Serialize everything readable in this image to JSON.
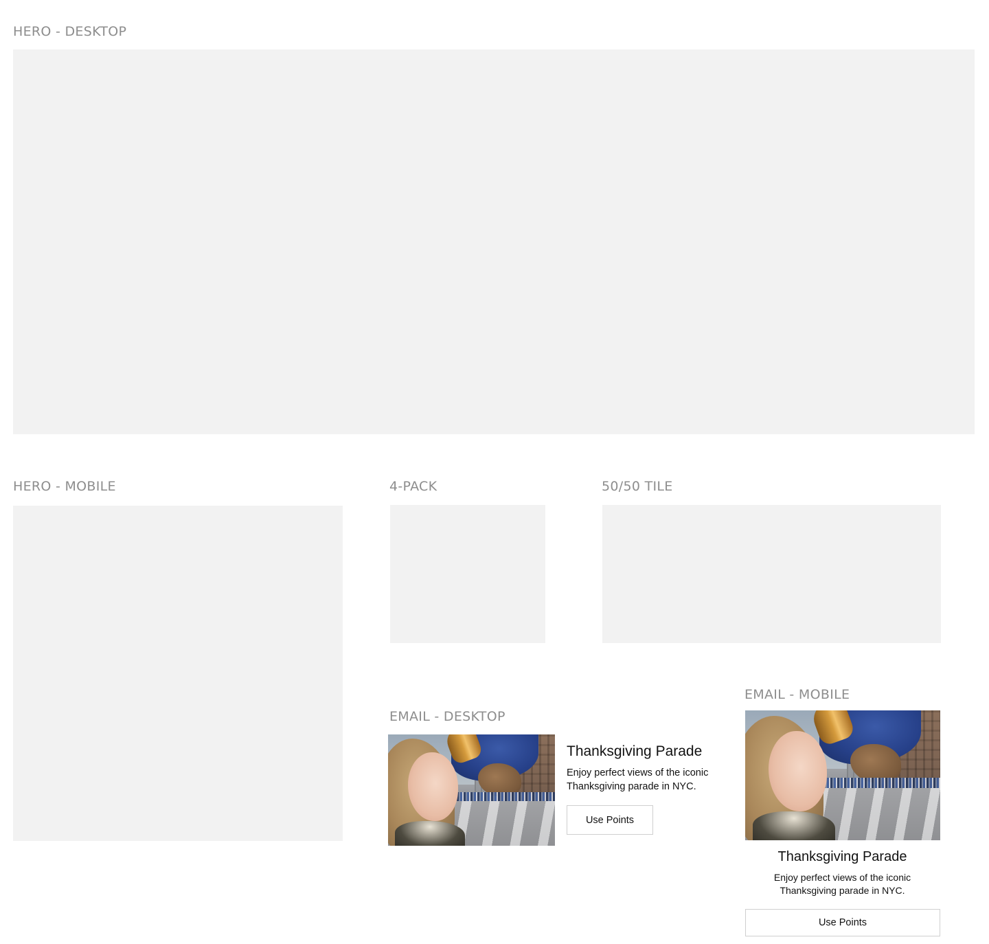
{
  "sections": {
    "hero_desktop": {
      "label": "HERO - DESKTOP"
    },
    "hero_mobile": {
      "label": "HERO - MOBILE"
    },
    "four_pack": {
      "label": "4-PACK"
    },
    "fifty_fifty": {
      "label": "50/50 TILE"
    },
    "email_desktop": {
      "label": "EMAIL - DESKTOP",
      "title": "Thanksgiving Parade",
      "description": "Enjoy perfect views of the iconic Thanksgiving parade in NYC.",
      "button_label": "Use Points"
    },
    "email_mobile": {
      "label": "EMAIL - MOBILE",
      "title": "Thanksgiving Parade",
      "description": "Enjoy perfect views of the iconic Thanksgiving parade in NYC.",
      "button_label": "Use Points"
    }
  },
  "colors": {
    "placeholder": "#f2f2f2",
    "label": "#8d8d8d",
    "button_border": "#cfcfcf"
  }
}
